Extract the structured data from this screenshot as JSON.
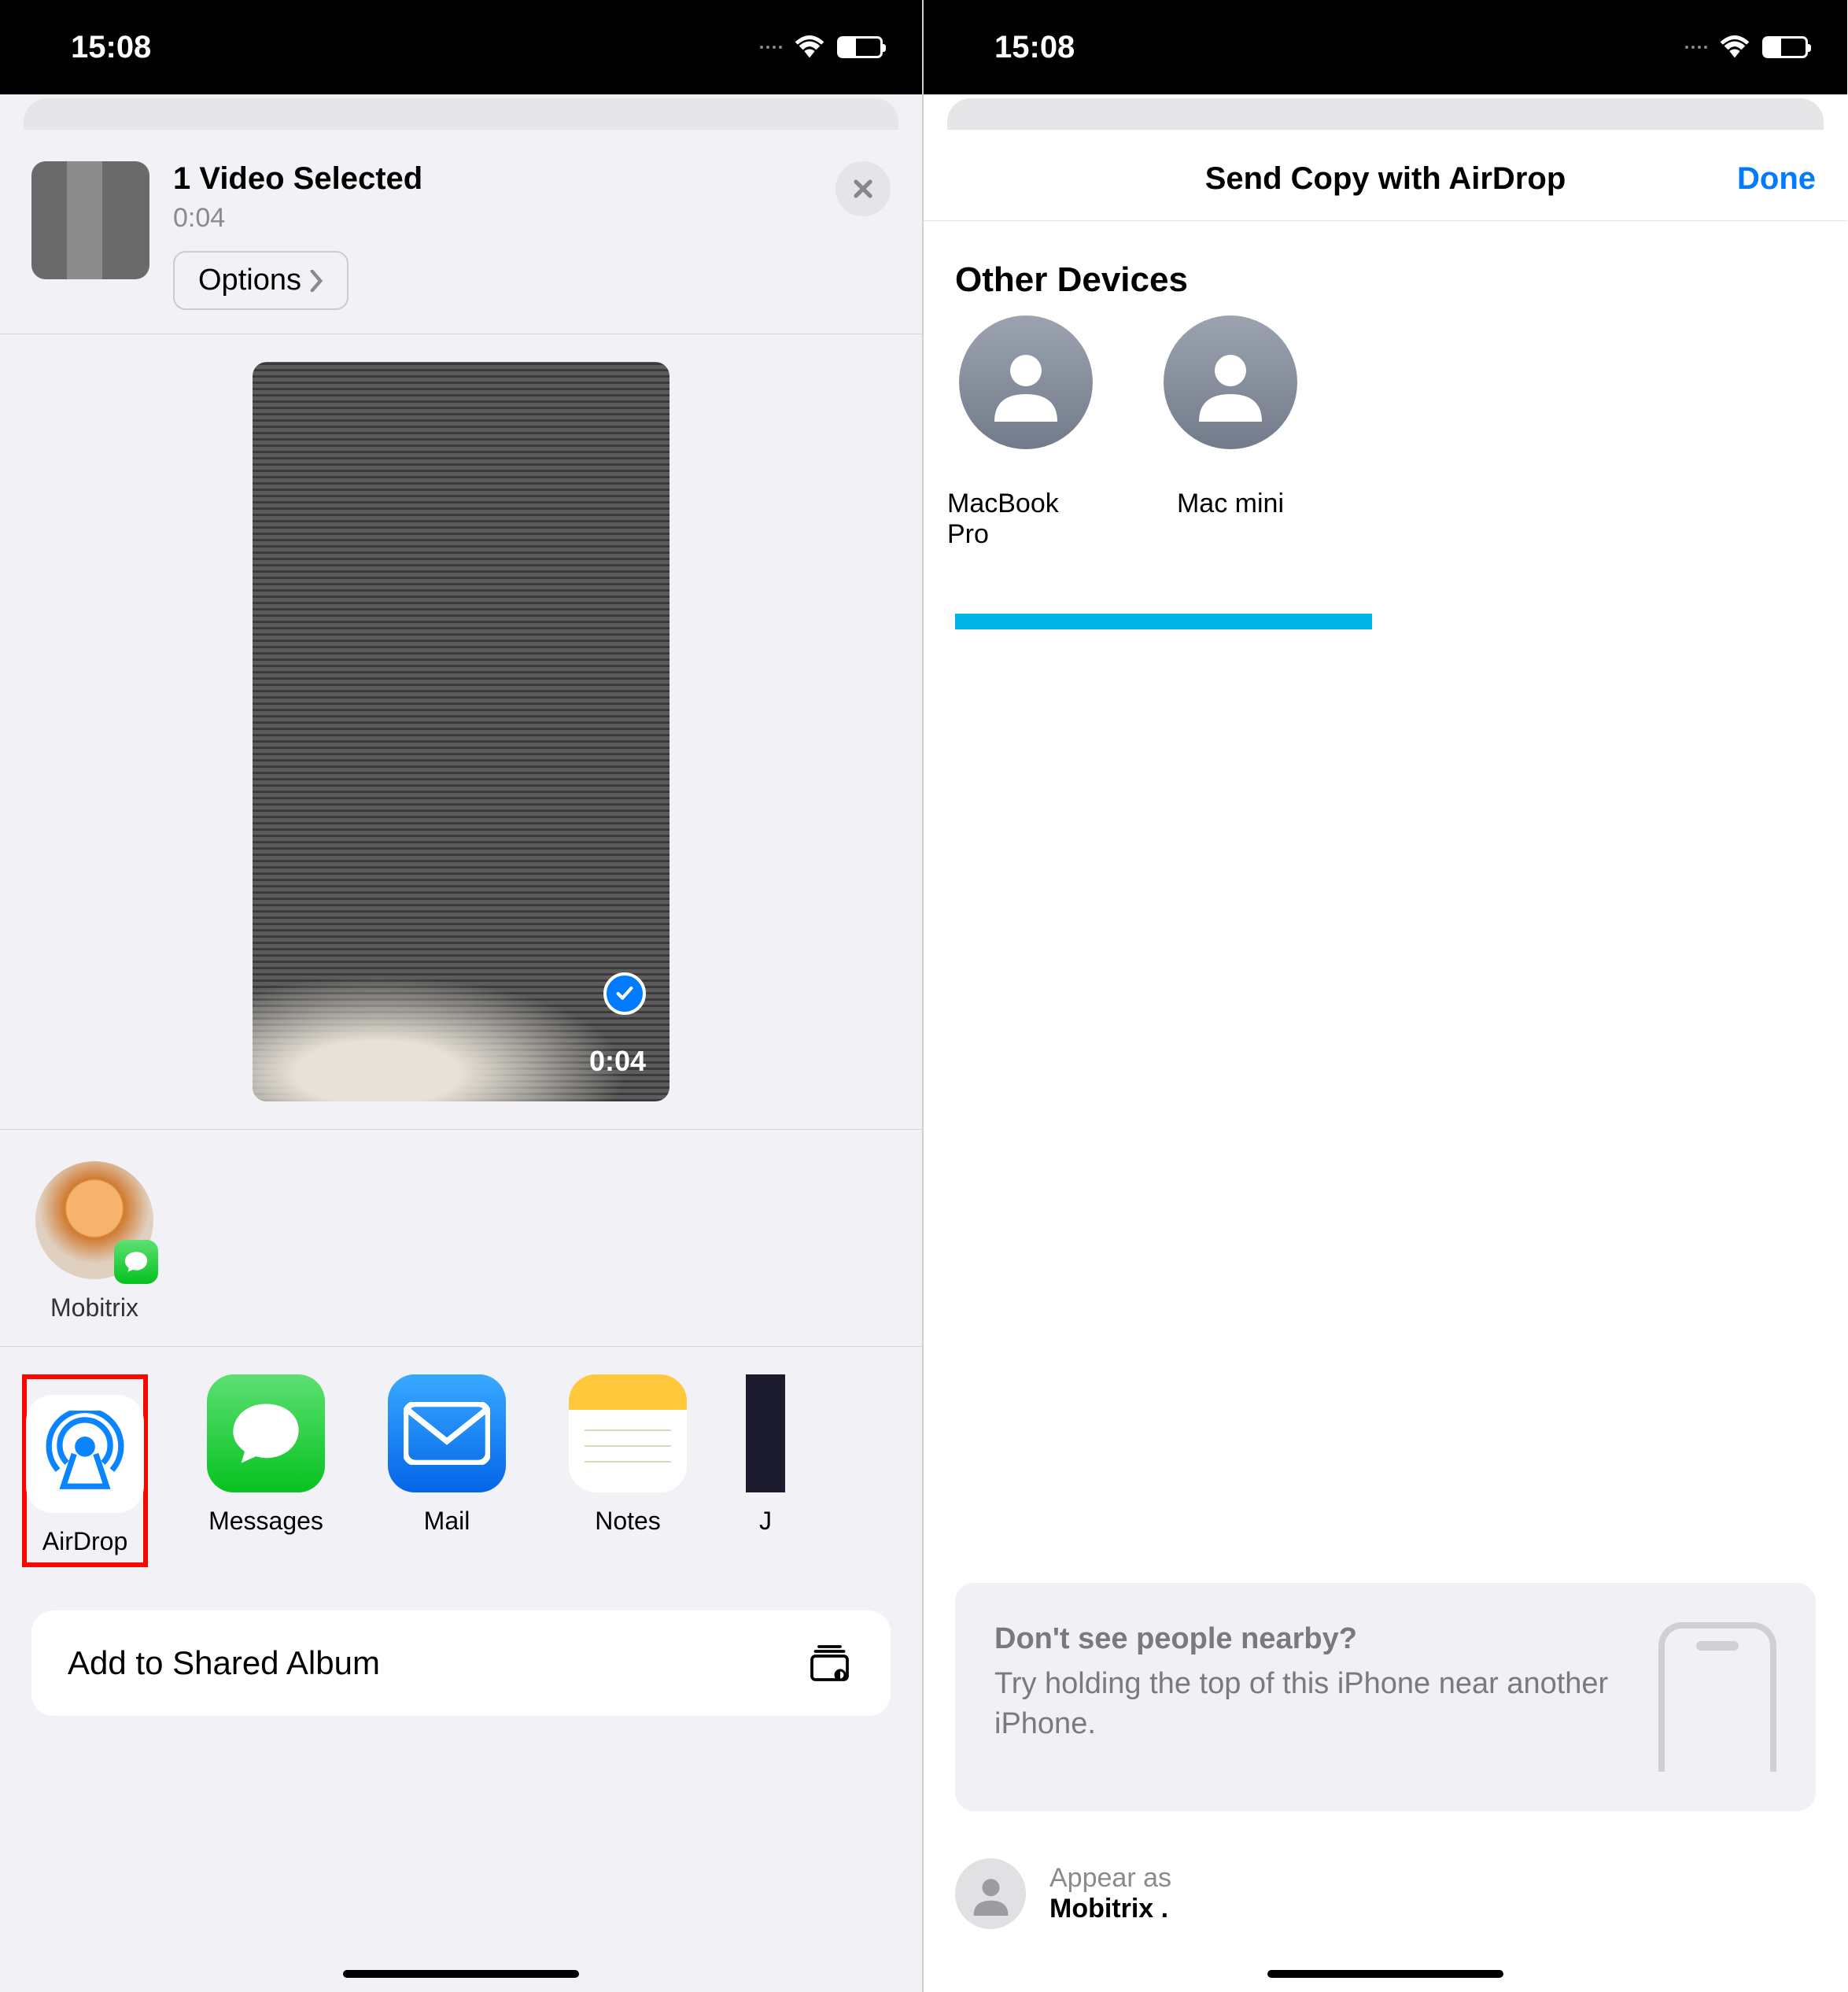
{
  "statusbar": {
    "time": "15:08"
  },
  "share": {
    "title": "1 Video Selected",
    "duration": "0:04",
    "options_label": "Options"
  },
  "preview": {
    "duration": "0:04"
  },
  "contacts": [
    {
      "name": "Mobitrix"
    }
  ],
  "apps": [
    {
      "id": "airdrop",
      "label": "AirDrop"
    },
    {
      "id": "messages",
      "label": "Messages"
    },
    {
      "id": "mail",
      "label": "Mail"
    },
    {
      "id": "notes",
      "label": "Notes"
    },
    {
      "id": "cut",
      "label": "J"
    }
  ],
  "actions": [
    {
      "label": "Add to Shared Album"
    }
  ],
  "airdrop_screen": {
    "title": "Send Copy with AirDrop",
    "done_label": "Done",
    "section": "Other Devices",
    "devices": [
      {
        "name": "MacBook Pro"
      },
      {
        "name": "Mac mini"
      }
    ],
    "hint_title": "Don't see people nearby?",
    "hint_body": "Try holding the top of this iPhone near another iPhone.",
    "appear_label": "Appear as",
    "appear_name": "Mobitrix ."
  }
}
